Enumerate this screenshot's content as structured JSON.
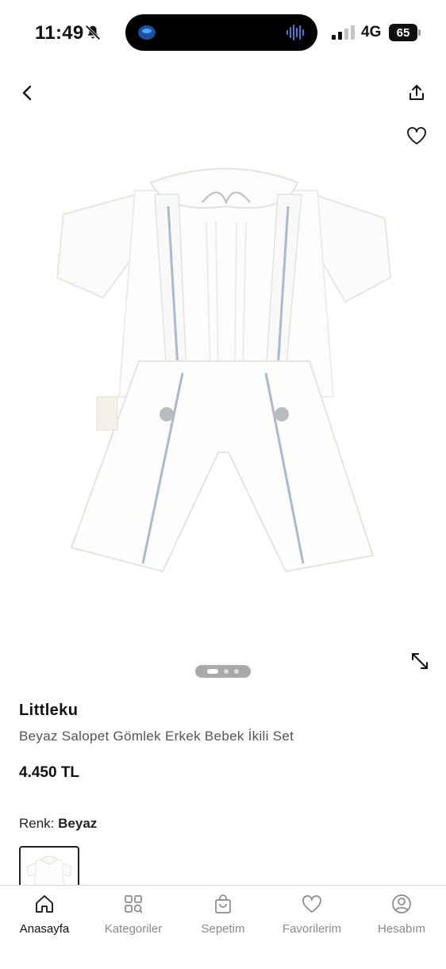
{
  "status_bar": {
    "time": "11:49",
    "network": "4G",
    "battery": "65"
  },
  "product": {
    "brand": "Littleku",
    "name": "Beyaz Salopet Gömlek Erkek Bebek İkili Set",
    "price": "4.450 TL",
    "color_label": "Renk:",
    "color_value": "Beyaz",
    "gallery": {
      "count": 3,
      "active_index": 0
    }
  },
  "tabbar": {
    "items": [
      {
        "label": "Anasayfa",
        "icon": "home-icon",
        "active": true
      },
      {
        "label": "Kategoriler",
        "icon": "categories-icon",
        "active": false
      },
      {
        "label": "Sepetim",
        "icon": "bag-icon",
        "active": false
      },
      {
        "label": "Favorilerim",
        "icon": "heart-icon",
        "active": false
      },
      {
        "label": "Hesabım",
        "icon": "account-icon",
        "active": false
      }
    ]
  },
  "colors": {
    "accent": "#111111",
    "muted": "#8a8a8a",
    "border": "#dadada"
  }
}
